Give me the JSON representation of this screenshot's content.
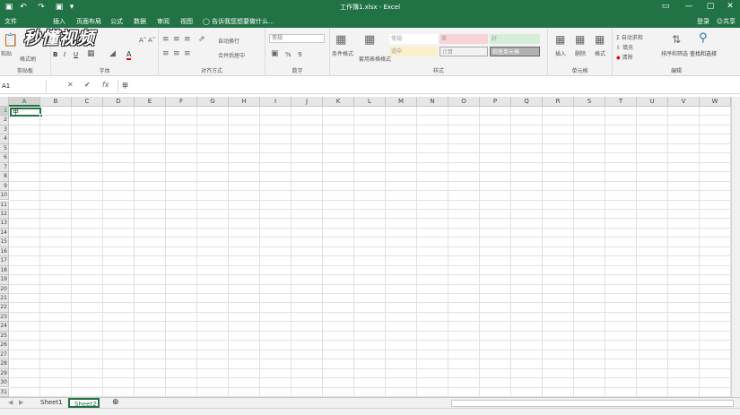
{
  "window": {
    "title": "工作簿1.xlsx - Excel"
  },
  "quick_access": {
    "save": "▣",
    "undo": "↶",
    "redo": "↷",
    "customize": "▾"
  },
  "window_controls": {
    "ribbon_options": "▭",
    "minimize": "—",
    "restore": "▢",
    "close": "✕"
  },
  "tabs": [
    "文件",
    "开始",
    "插入",
    "页面布局",
    "公式",
    "数据",
    "审阅",
    "视图"
  ],
  "active_tab": "开始",
  "tell_me": "告诉我您想要做什么...",
  "sign_in": "登录",
  "share": "共享",
  "watermark": "秒懂视频",
  "ribbon": {
    "clipboard": {
      "label": "剪贴板",
      "paste": "粘贴",
      "format_painter": "格式刷"
    },
    "font": {
      "label": "字体",
      "bold": "B",
      "italic": "I",
      "underline": "U",
      "grow": "A˄",
      "shrink": "A˅",
      "font_color": "A"
    },
    "alignment": {
      "label": "对齐方式",
      "wrap": "自动换行",
      "merge": "合并后居中"
    },
    "number": {
      "label": "数字",
      "format": "常规",
      "percent": "%",
      "comma": "9"
    },
    "styles": {
      "label": "样式",
      "conditional": "条件格式",
      "table": "套用表格格式",
      "cells": [
        "常规",
        "差",
        "好",
        "适中",
        "计算",
        "检查单元格"
      ]
    },
    "cells": {
      "label": "单元格",
      "insert": "插入",
      "delete": "删除",
      "format": "格式"
    },
    "editing": {
      "label": "编辑",
      "autosum": "自动求和",
      "fill": "填充",
      "clear": "清除",
      "sort_filter": "排序和筛选",
      "find_select": "查找和选择"
    }
  },
  "formula_bar": {
    "name_box": "A1",
    "cancel": "✕",
    "enter": "✔",
    "fx": "fx",
    "content": "甲"
  },
  "columns": [
    "A",
    "B",
    "C",
    "D",
    "E",
    "F",
    "G",
    "H",
    "I",
    "J",
    "K",
    "L",
    "M",
    "N",
    "O",
    "P",
    "Q",
    "R",
    "S",
    "T",
    "U",
    "V",
    "W"
  ],
  "rows": [
    "1",
    "2",
    "3",
    "4",
    "5",
    "6",
    "7",
    "8",
    "9",
    "10",
    "11",
    "12",
    "13",
    "14",
    "15",
    "16",
    "17",
    "18",
    "19",
    "20",
    "21",
    "22",
    "23",
    "24",
    "25",
    "26",
    "27",
    "28",
    "29",
    "30",
    "31"
  ],
  "selected_cell": {
    "ref": "A1",
    "value": "甲"
  },
  "sheets": [
    "Sheet1",
    "Sheet2"
  ],
  "active_sheet": "Sheet2",
  "add_sheet": "⊕",
  "colors": {
    "accent": "#217346",
    "ribbon_bg": "#f3f3f3"
  }
}
